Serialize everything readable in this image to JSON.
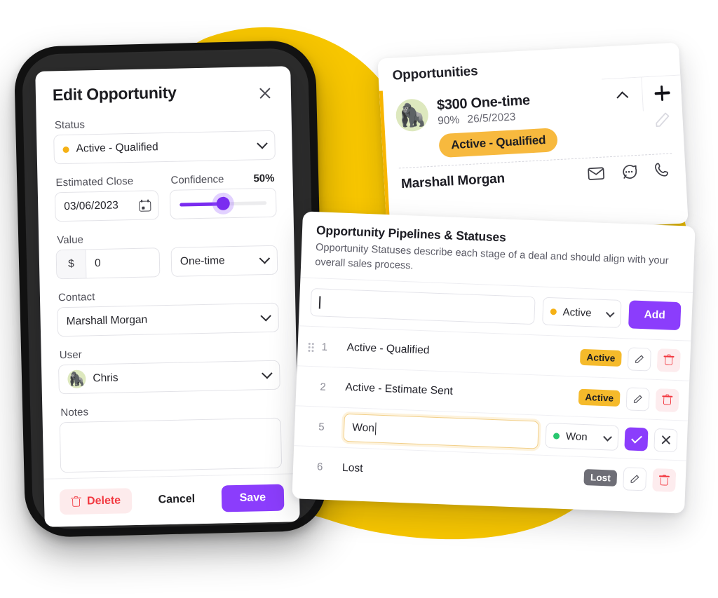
{
  "theme": {
    "accent_purple": "#8B3DFC",
    "accent_yellow": "#F7C600",
    "status_amber": "#F5B115",
    "status_green": "#28C76F",
    "danger_red": "#F2373F",
    "badge_active": "#F5BA2B",
    "badge_lost": "#6E6E76"
  },
  "edit_dialog": {
    "title": "Edit Opportunity",
    "close_icon": "close-icon",
    "status": {
      "label": "Status",
      "value": "Active - Qualified",
      "dot_color": "#F5B115",
      "chevron_icon": "chevron-down-icon"
    },
    "estimated_close": {
      "label": "Estimated Close",
      "value": "03/06/2023",
      "calendar_icon": "calendar-icon"
    },
    "confidence": {
      "label": "Confidence",
      "value_label": "50%",
      "percent": 50
    },
    "value": {
      "label": "Value",
      "currency_symbol": "$",
      "amount": "0"
    },
    "frequency": {
      "value": "One-time",
      "chevron_icon": "chevron-down-icon"
    },
    "contact": {
      "label": "Contact",
      "value": "Marshall Morgan",
      "chevron_icon": "chevron-down-icon"
    },
    "user": {
      "label": "User",
      "value": "Chris",
      "avatar_glyph": "🦍",
      "chevron_icon": "chevron-down-icon"
    },
    "notes": {
      "label": "Notes",
      "value": ""
    },
    "footer": {
      "delete_label": "Delete",
      "delete_icon": "trash-icon",
      "cancel_label": "Cancel",
      "save_label": "Save"
    }
  },
  "opportunities_card": {
    "title": "Opportunities",
    "collapse_icon": "chevron-up-icon",
    "add_icon": "plus-icon",
    "edit_icon": "pencil-icon",
    "item": {
      "avatar_glyph": "🦍",
      "title": "$300 One-time",
      "confidence": "90%",
      "date": "26/5/2023",
      "status_badge": "Active - Qualified",
      "contact_name": "Marshall Morgan",
      "contact_actions": [
        {
          "name": "email-icon",
          "label": "Email"
        },
        {
          "name": "message-icon",
          "label": "Message"
        },
        {
          "name": "phone-icon",
          "label": "Call"
        }
      ]
    }
  },
  "pipelines_card": {
    "title": "Opportunity Pipelines & Statuses",
    "description": "Opportunity Statuses describe each stage of a deal and should align with your overall sales process.",
    "add_row": {
      "input_value": "",
      "input_placeholder": "",
      "status_select": "Active",
      "status_dot_color": "#F5B115",
      "add_label": "Add",
      "chevron_icon": "chevron-down-icon"
    },
    "rows": [
      {
        "order": "1",
        "name": "Active - Qualified",
        "badge": "Active",
        "badge_kind": "active",
        "editing": false,
        "has_drag_handle": true,
        "edit_icon": "pencil-icon",
        "delete_icon": "trash-icon"
      },
      {
        "order": "2",
        "name": "Active - Estimate Sent",
        "badge": "Active",
        "badge_kind": "active",
        "editing": false,
        "has_drag_handle": false,
        "edit_icon": "pencil-icon",
        "delete_icon": "trash-icon"
      },
      {
        "order": "5",
        "name": "Won",
        "badge": "Won",
        "badge_kind": "won",
        "editing": true,
        "has_drag_handle": false,
        "select_value": "Won",
        "select_dot_color": "#28C76F",
        "confirm_icon": "check-icon",
        "cancel_icon": "close-icon"
      },
      {
        "order": "6",
        "name": "Lost",
        "badge": "Lost",
        "badge_kind": "lost",
        "editing": false,
        "has_drag_handle": false,
        "edit_icon": "pencil-icon",
        "delete_icon": "trash-icon"
      }
    ]
  }
}
